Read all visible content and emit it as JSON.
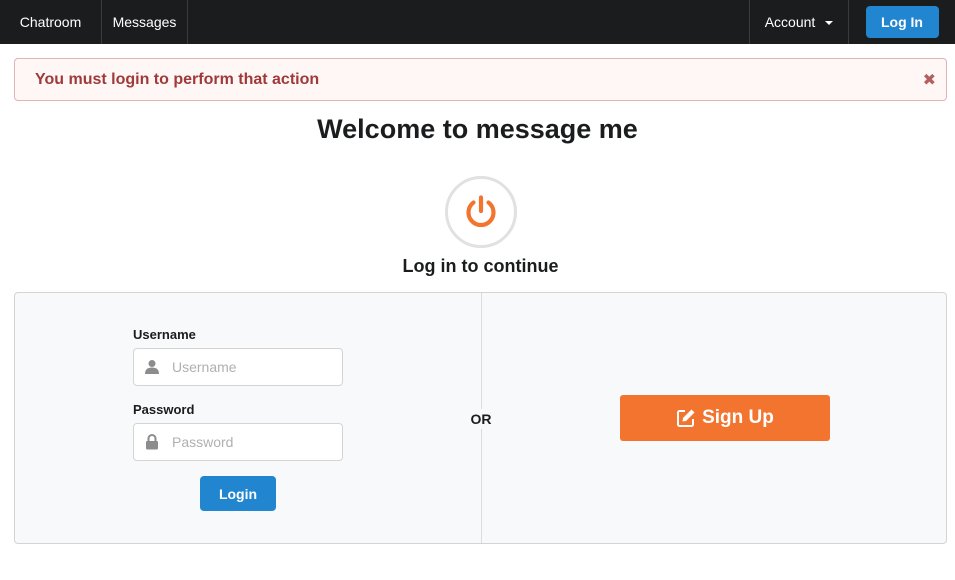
{
  "navbar": {
    "chatroom_label": "Chatroom",
    "messages_label": "Messages",
    "account_label": "Account",
    "login_label": "Log In"
  },
  "alert": {
    "message": "You must login to perform that action",
    "close_glyph": "✖"
  },
  "main": {
    "title": "Welcome to message me",
    "subtitle": "Log in to continue"
  },
  "login_form": {
    "username_label": "Username",
    "username_placeholder": "Username",
    "username_value": "",
    "password_label": "Password",
    "password_placeholder": "Password",
    "password_value": "",
    "submit_label": "Login"
  },
  "divider": {
    "label": "OR"
  },
  "signup": {
    "label": "Sign Up"
  },
  "colors": {
    "navbar_bg": "#1b1c1d",
    "primary_blue": "#2185d0",
    "signup_orange": "#f2742f",
    "power_icon_orange": "#f2742f",
    "alert_text": "#9f3a38",
    "alert_bg": "#fff6f6"
  },
  "icons": {
    "power": "power-icon",
    "user": "user-icon",
    "lock": "lock-icon",
    "edit": "edit-icon",
    "dropdown": "caret-down-icon",
    "close": "close-icon"
  }
}
